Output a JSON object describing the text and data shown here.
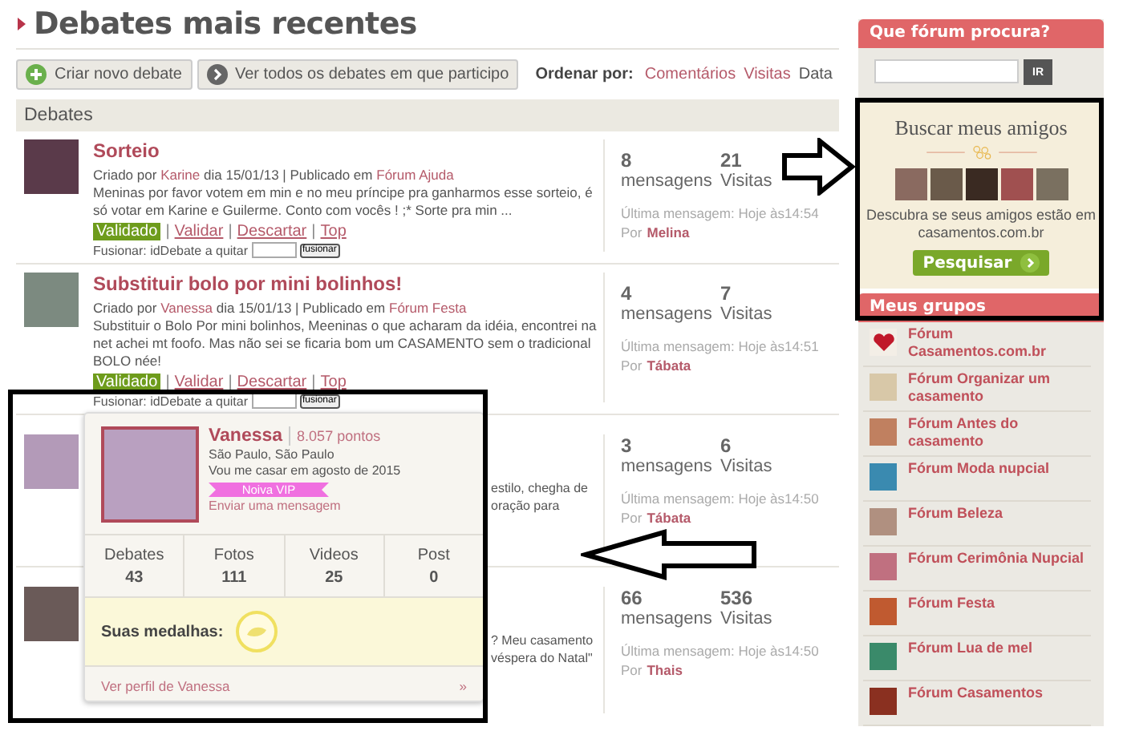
{
  "page": {
    "title": "Debates mais recentes"
  },
  "actions": [
    {
      "kind": "create",
      "label": "Criar novo debate"
    },
    {
      "kind": "view",
      "label": "Ver todos os debates em que participo"
    }
  ],
  "sort": {
    "label": "Ordenar por:",
    "options": [
      {
        "label": "Comentários",
        "selected": false
      },
      {
        "label": "Visitas",
        "selected": false
      },
      {
        "label": "Data",
        "selected": true
      }
    ]
  },
  "section_header": "Debates",
  "debates": [
    {
      "kind": "full",
      "title": "Sorteio",
      "meta": [
        {
          "kind": "text",
          "text": "Criado por"
        },
        {
          "kind": "link",
          "text": "Karine"
        },
        {
          "kind": "text",
          "text": "dia 15/01/13 | Publicado em"
        },
        {
          "kind": "link",
          "text": "Fórum Ajuda"
        }
      ],
      "excerpt": "Meninas por favor votem em min e no meu príncipe pra ganharmos esse sorteio, é só votar em Karine e Guilerme. Conto com vocês ! ;* Sorte pra min ...",
      "moderation": {
        "status": "Validado",
        "separator": "|",
        "links": [
          "Validar",
          "Descartar",
          "Top"
        ]
      },
      "merge": {
        "label": "Fusionar: idDebate a quitar",
        "button": "fusionar"
      },
      "stats": {
        "messages": "8",
        "messages_label": "mensagens",
        "visits": "21",
        "visits_label": "Visitas",
        "last_message": "Última mensagem: Hoje às14:54",
        "by_label": "Por",
        "by": "Melina"
      }
    },
    {
      "kind": "full",
      "title": "Substituir bolo por mini bolinhos!",
      "meta": [
        {
          "kind": "text",
          "text": "Criado por"
        },
        {
          "kind": "link",
          "text": "Vanessa"
        },
        {
          "kind": "text",
          "text": "dia 15/01/13 | Publicado em"
        },
        {
          "kind": "link",
          "text": "Fórum Festa"
        }
      ],
      "excerpt": "Substituir o Bolo Por mini bolinhos, Meeninas o que acharam da idéia, encontrei na net achei mt foofo. Mas não sei se ficaria bom um CASAMENTO sem o tradicional BOLO née!",
      "moderation": {
        "status": "Validado",
        "separator": "|",
        "links": [
          "Validar",
          "Descartar",
          "Top"
        ]
      },
      "merge": {
        "label": "Fusionar: idDebate a quitar",
        "button": "fusionar"
      },
      "stats": {
        "messages": "4",
        "messages_label": "mensagens",
        "visits": "7",
        "visits_label": "Visitas",
        "last_message": "Última mensagem: Hoje às14:51",
        "by_label": "Por",
        "by": "Tábata"
      }
    },
    {
      "kind": "partial",
      "excerpt_lines": [
        "estilo, chegha de",
        "oração para"
      ],
      "stats": {
        "messages": "3",
        "messages_label": "mensagens",
        "visits": "6",
        "visits_label": "Visitas",
        "last_message": "Última mensagem: Hoje às14:50",
        "by_label": "Por",
        "by": "Tábata"
      }
    },
    {
      "kind": "partial",
      "excerpt_lines": [
        "? Meu casamento",
        "véspera do Natal\""
      ],
      "stats": {
        "messages": "66",
        "messages_label": "mensagens",
        "visits": "536",
        "visits_label": "Visitas",
        "last_message": "Última mensagem: Hoje às14:50",
        "by_label": "Por",
        "by": "Thais"
      }
    }
  ],
  "profile_popup": {
    "name": "Vanessa",
    "points": "8.057 pontos",
    "location": "São Paulo, São Paulo",
    "wedding": "Vou me casar em agosto de 2015",
    "badge": "Noiva VIP",
    "message_link": "Enviar uma mensagem",
    "stats": [
      {
        "label": "Debates",
        "value": "43"
      },
      {
        "label": "Fotos",
        "value": "111"
      },
      {
        "label": "Videos",
        "value": "25"
      },
      {
        "label": "Post",
        "value": "0"
      }
    ],
    "medals_label": "Suas medalhas:",
    "profile_link": "Ver perfil de Vanessa",
    "more": "»"
  },
  "sidebar": {
    "search": {
      "title": "Que fórum procura?",
      "button": "IR"
    },
    "friends": {
      "title": "Buscar meus amigos",
      "description": "Descubra se seus amigos estão em casamentos.com.br",
      "button": "Pesquisar"
    },
    "groups": {
      "title": "Meus grupos",
      "items": [
        "Fórum Casamentos.com.br",
        "Fórum Organizar um casamento",
        "Fórum Antes do casamento",
        "Fórum Moda nupcial",
        "Fórum Beleza",
        "Fórum Cerimônia Nupcial",
        "Fórum Festa",
        "Fórum Lua de mel",
        "Fórum Casamentos"
      ]
    }
  }
}
